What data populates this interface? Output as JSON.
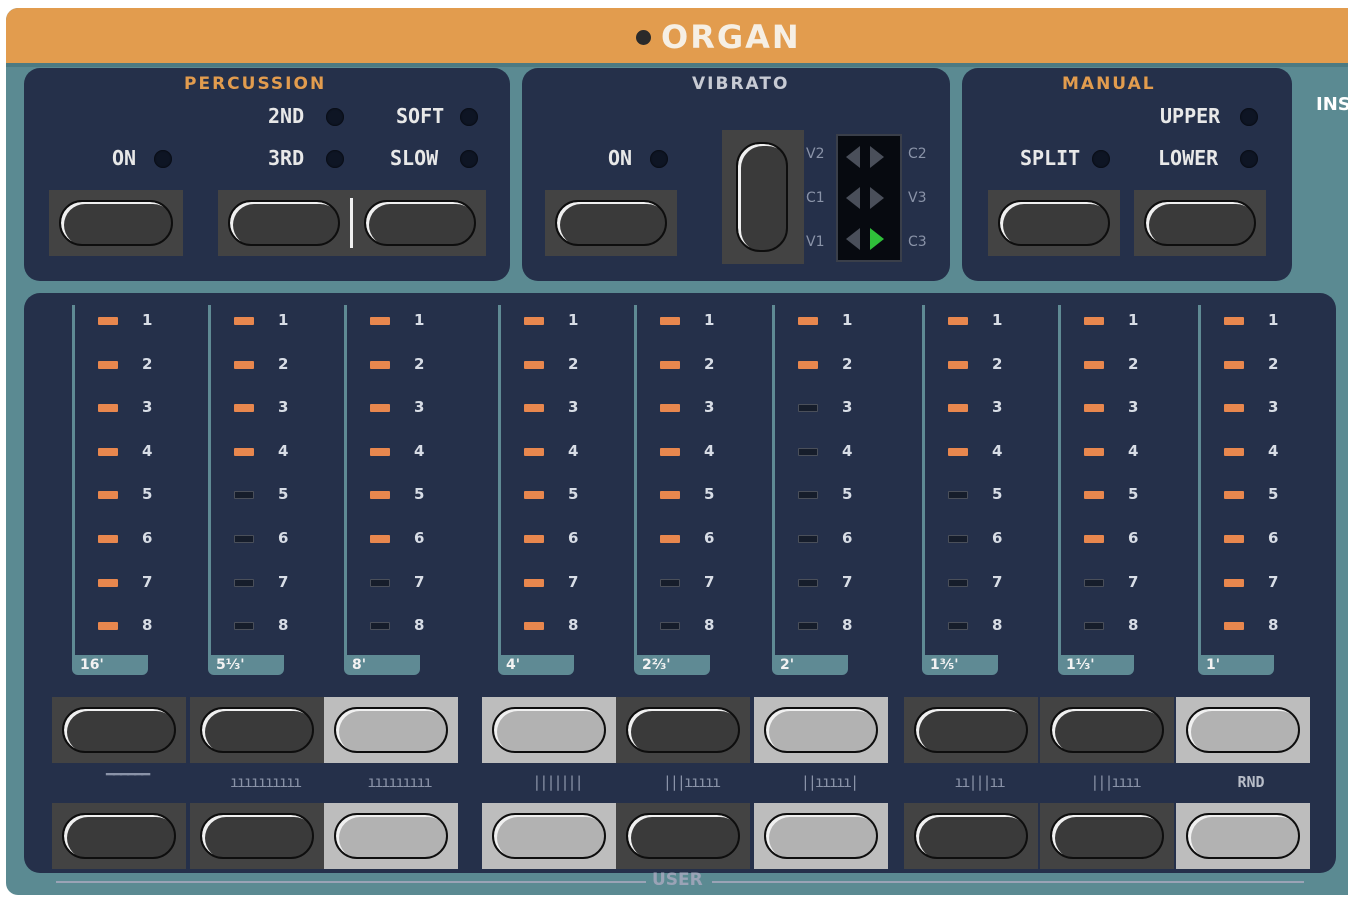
{
  "title": "ORGAN",
  "sections": {
    "percussion": {
      "title": "PERCUSSION",
      "on": "ON",
      "second": "2ND",
      "third": "3RD",
      "soft": "SOFT",
      "slow": "SLOW"
    },
    "vibrato": {
      "title": "VIBRATO",
      "on": "ON",
      "modes_left": [
        "V2",
        "C1",
        "V1"
      ],
      "modes_right": [
        "C2",
        "V3",
        "C3"
      ],
      "selected": "C3"
    },
    "manual": {
      "title": "MANUAL",
      "split": "SPLIT",
      "upper": "UPPER",
      "lower": "LOWER"
    },
    "cut_label": "INS"
  },
  "drawbars": [
    {
      "label": "16'",
      "level": 8
    },
    {
      "label": "5⅓'",
      "level": 4
    },
    {
      "label": "8'",
      "level": 6
    },
    {
      "label": "4'",
      "level": 8
    },
    {
      "label": "2⅔'",
      "level": 6
    },
    {
      "label": "2'",
      "level": 2
    },
    {
      "label": "1⅗'",
      "level": 4
    },
    {
      "label": "1⅓'",
      "level": 6
    },
    {
      "label": "1'",
      "level": 8
    }
  ],
  "level_numbers": [
    "1",
    "2",
    "3",
    "4",
    "5",
    "6",
    "7",
    "8"
  ],
  "preset_labels": [
    "▔▔▔▔▔▔",
    "ıııııııııı",
    "ııııııııı",
    "|||||||",
    "|||ııııı",
    "||ııııı|",
    "ıı|||ıı",
    "|||ıııı",
    "RND"
  ],
  "preset_lit_top": [
    false,
    false,
    true,
    true,
    false,
    true,
    false,
    false,
    true
  ],
  "preset_lit_bottom": [
    false,
    false,
    true,
    true,
    false,
    true,
    false,
    false,
    true
  ],
  "footer": {
    "user": "USER"
  },
  "colors": {
    "orange": "#e29c4e",
    "panel": "#25304a",
    "teal": "#5b8a92",
    "led_on": "#e8874e",
    "vibrato_on": "#2fbf3a"
  }
}
